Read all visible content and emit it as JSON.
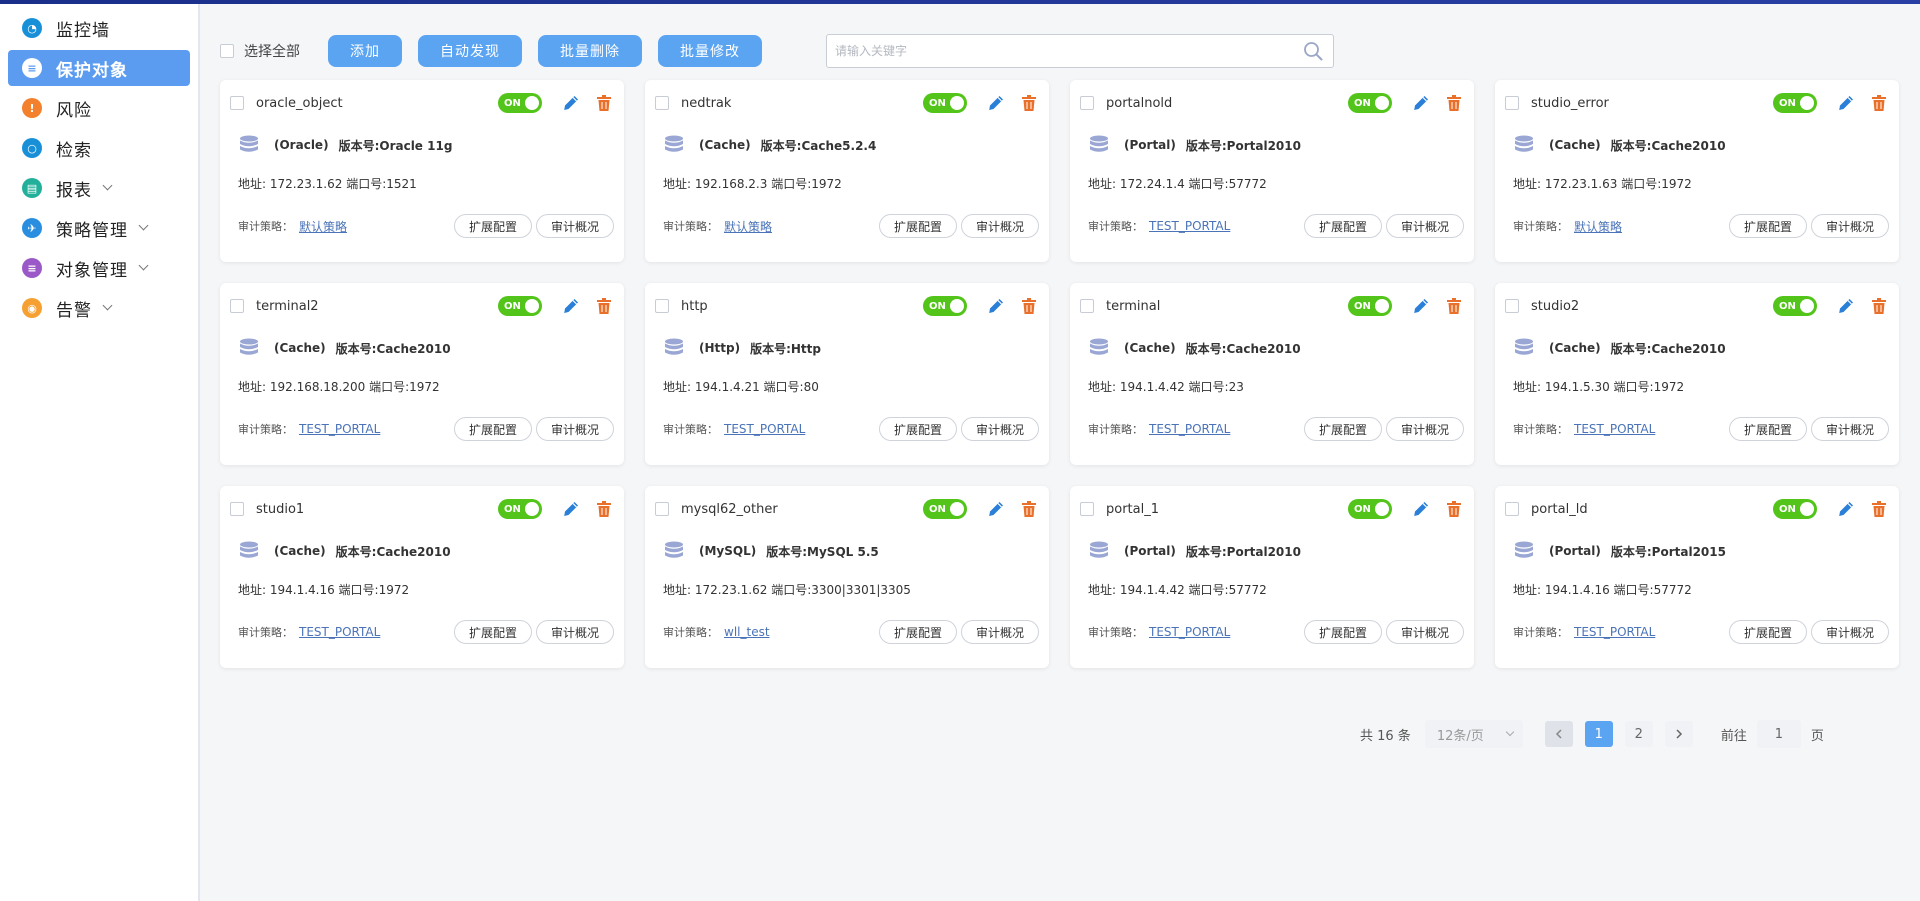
{
  "sidebar": {
    "items": [
      {
        "label": "监控墙",
        "icon": "dashboard-icon",
        "color": "#1890d8",
        "glyph": "◔",
        "active": false,
        "chevron": false
      },
      {
        "label": "保护对象",
        "icon": "database-icon",
        "color": "#5b9cf0",
        "glyph": "≡",
        "active": true,
        "chevron": false
      },
      {
        "label": "风险",
        "icon": "warning-icon",
        "color": "#f2802c",
        "glyph": "!",
        "active": false,
        "chevron": false
      },
      {
        "label": "检索",
        "icon": "search-icon",
        "color": "#1890d8",
        "glyph": "○",
        "active": false,
        "chevron": false
      },
      {
        "label": "报表",
        "icon": "report-icon",
        "color": "#23b09a",
        "glyph": "▤",
        "active": false,
        "chevron": true
      },
      {
        "label": "策略管理",
        "icon": "policy-icon",
        "color": "#2a8ee0",
        "glyph": "✈",
        "active": false,
        "chevron": true
      },
      {
        "label": "对象管理",
        "icon": "object-manage-icon",
        "color": "#9b59c8",
        "glyph": "≡",
        "active": false,
        "chevron": true
      },
      {
        "label": "告警",
        "icon": "alarm-icon",
        "color": "#f5a030",
        "glyph": "◉",
        "active": false,
        "chevron": true
      }
    ]
  },
  "toolbar": {
    "select_all": "选择全部",
    "add": "添加",
    "auto_discover": "自动发现",
    "batch_delete": "批量删除",
    "batch_edit": "批量修改",
    "search_placeholder": "请输入关键字"
  },
  "card_labels": {
    "toggle": "ON",
    "addr_prefix": "地址:",
    "port_prefix": "端口号:",
    "version_prefix": "版本号:",
    "policy_label": "审计策略：",
    "extend_config": "扩展配置",
    "audit_overview": "审计概况"
  },
  "cards": [
    {
      "name": "oracle_object",
      "type": "(Oracle)",
      "version": "版本号:Oracle 11g",
      "addr": "地址: 172.23.1.62 端口号:1521",
      "policy": "默认策略"
    },
    {
      "name": "nedtrak",
      "type": "(Cache)",
      "version": "版本号:Cache5.2.4",
      "addr": "地址: 192.168.2.3 端口号:1972",
      "policy": "默认策略"
    },
    {
      "name": "portalnold",
      "type": "(Portal)",
      "version": "版本号:Portal2010",
      "addr": "地址: 172.24.1.4 端口号:57772",
      "policy": "TEST_PORTAL"
    },
    {
      "name": "studio_error",
      "type": "(Cache)",
      "version": "版本号:Cache2010",
      "addr": "地址: 172.23.1.63 端口号:1972",
      "policy": "默认策略"
    },
    {
      "name": "terminal2",
      "type": "(Cache)",
      "version": "版本号:Cache2010",
      "addr": "地址: 192.168.18.200 端口号:1972",
      "policy": "TEST_PORTAL"
    },
    {
      "name": "http",
      "type": "(Http)",
      "version": "版本号:Http",
      "addr": "地址: 194.1.4.21 端口号:80",
      "policy": "TEST_PORTAL"
    },
    {
      "name": "terminal",
      "type": "(Cache)",
      "version": "版本号:Cache2010",
      "addr": "地址: 194.1.4.42 端口号:23",
      "policy": "TEST_PORTAL"
    },
    {
      "name": "studio2",
      "type": "(Cache)",
      "version": "版本号:Cache2010",
      "addr": "地址: 194.1.5.30 端口号:1972",
      "policy": "TEST_PORTAL"
    },
    {
      "name": "studio1",
      "type": "(Cache)",
      "version": "版本号:Cache2010",
      "addr": "地址: 194.1.4.16 端口号:1972",
      "policy": "TEST_PORTAL"
    },
    {
      "name": "mysql62_other",
      "type": "(MySQL)",
      "version": "版本号:MySQL 5.5",
      "addr": "地址: 172.23.1.62 端口号:3300|3301|3305",
      "policy": "wll_test"
    },
    {
      "name": "portal_1",
      "type": "(Portal)",
      "version": "版本号:Portal2010",
      "addr": "地址: 194.1.4.42 端口号:57772",
      "policy": "TEST_PORTAL"
    },
    {
      "name": "portal_ld",
      "type": "(Portal)",
      "version": "版本号:Portal2015",
      "addr": "地址: 194.1.4.16 端口号:57772",
      "policy": "TEST_PORTAL"
    }
  ],
  "pagination": {
    "total": "共 16 条",
    "page_size": "12条/页",
    "pages": [
      "1",
      "2"
    ],
    "current": "1",
    "goto_label": "前往",
    "goto_value": "1",
    "page_suffix": "页"
  },
  "colors": {
    "accent": "#5ba4f2",
    "toggle_on": "#52c41a",
    "edit": "#2a7fd8",
    "delete": "#e8702a",
    "db_icon": "#9aa7d4"
  }
}
